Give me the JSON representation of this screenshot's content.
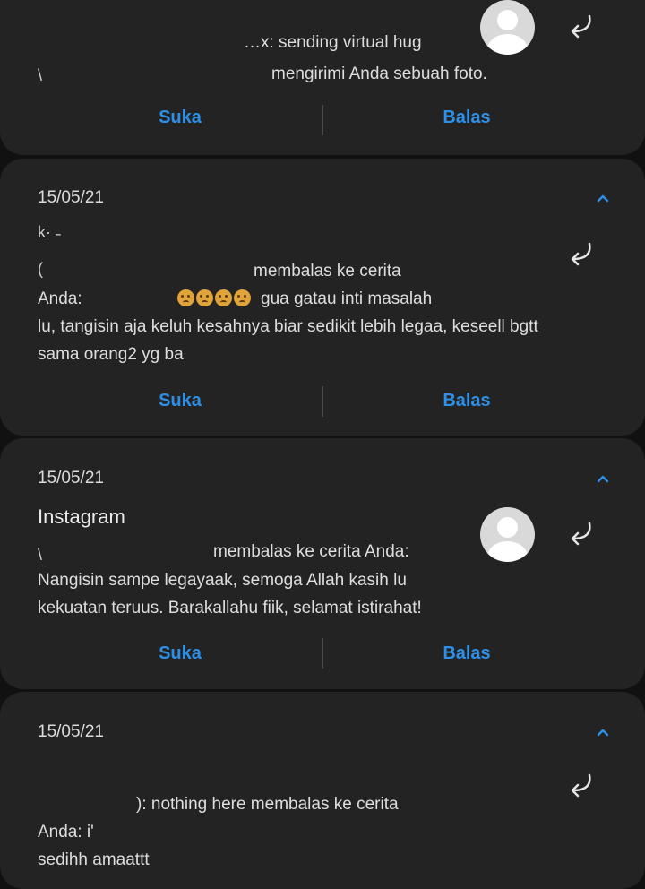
{
  "buttons": {
    "like": "Suka",
    "reply": "Balas"
  },
  "notifications": [
    {
      "date": "",
      "app": "",
      "line1": "…x: sending virtual hug",
      "line2": "mengirimi Anda sebuah foto."
    },
    {
      "date": "15/05/21",
      "app": "",
      "sender_fragment": "k· ˗",
      "reply_text": "membalas ke cerita",
      "anda_label": "Anda:",
      "msg_tail": "gua gatau inti masalah",
      "msg_rest": "lu, tangisin aja keluh kesahnya biar sedikit lebih legaa, keseell bgtt\nsama orang2 yg ba"
    },
    {
      "date": "15/05/21",
      "app": "Instagram",
      "reply_text": "membalas ke cerita Anda:",
      "msg_rest": "Nangisin sampe legayaak, semoga Allah kasih lu\nkekuatan teruus. Barakallahu fiik, selamat istirahat!"
    },
    {
      "date": "15/05/21",
      "app": "",
      "reply_text": "): nothing here membalas ke cerita",
      "anda_label": "Anda: i'",
      "msg_rest": "sedihh amaattt"
    }
  ],
  "colors": {
    "accent": "#2e8fe6",
    "card": "#232323",
    "background": "#111111"
  },
  "icons": [
    "collapse-chevron-icon",
    "reply-arrow-icon",
    "avatar-icon"
  ]
}
